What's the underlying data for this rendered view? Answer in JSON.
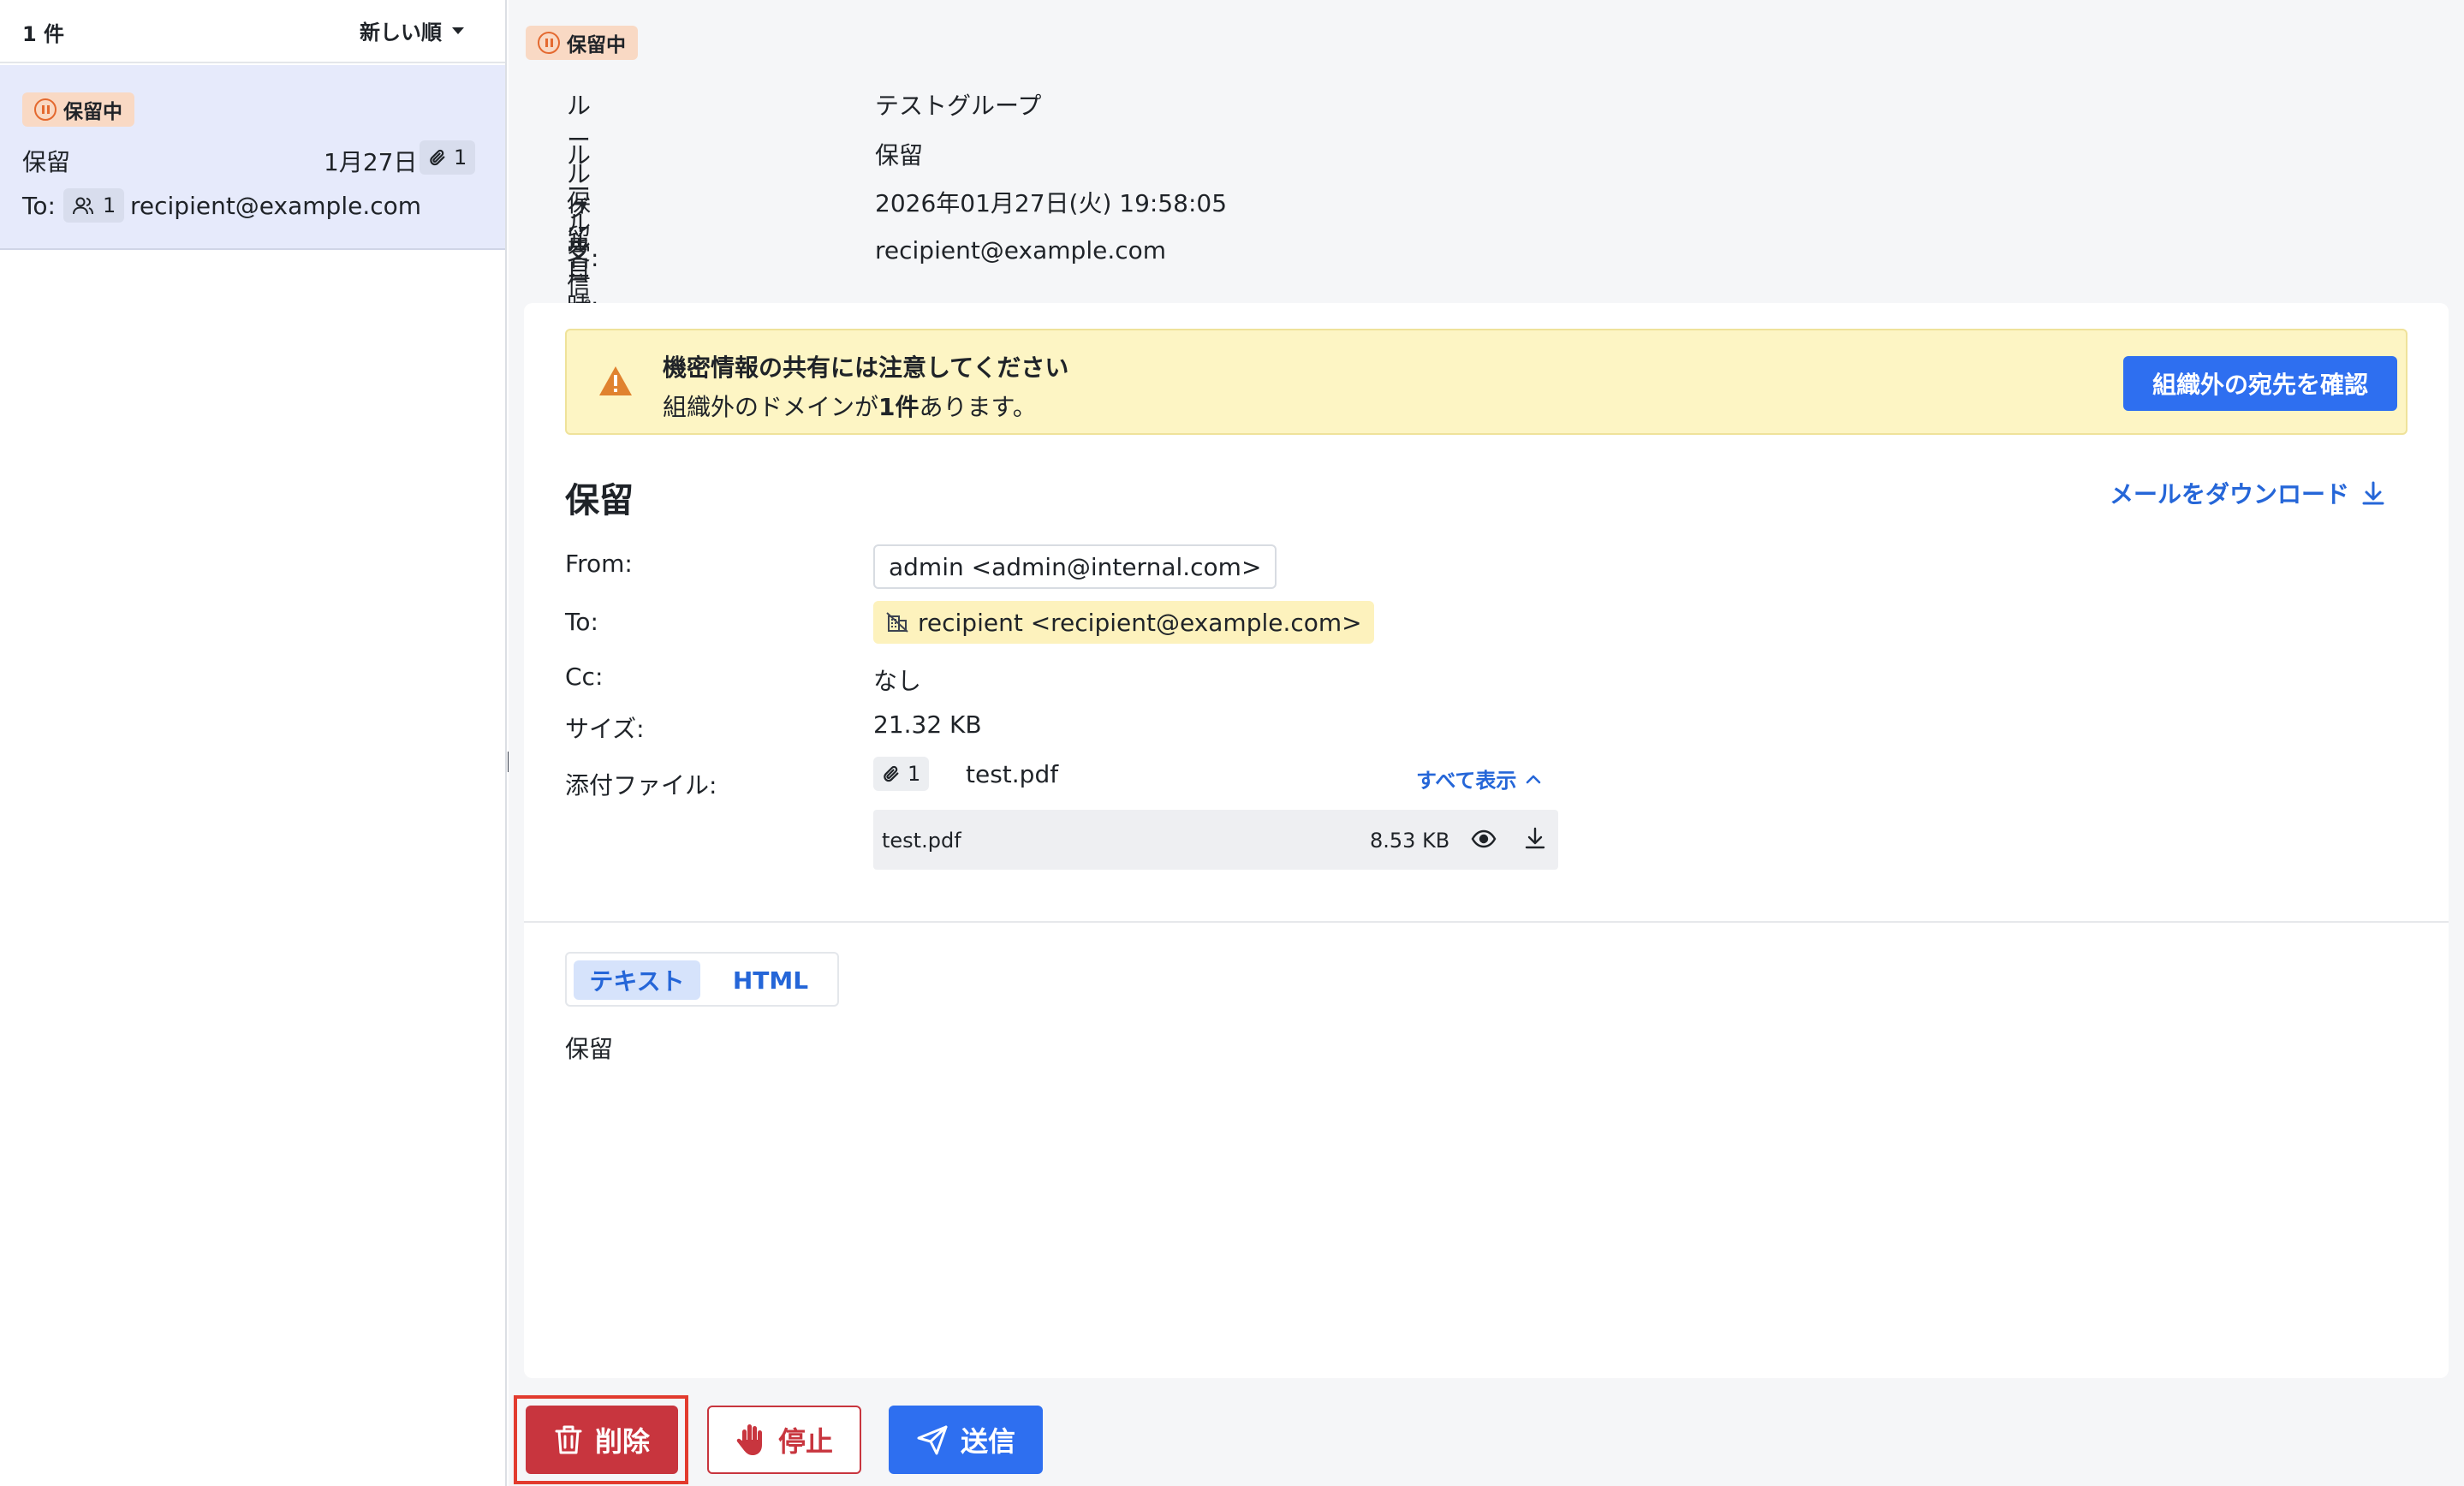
{
  "colors": {
    "accent": "#2e6ff0",
    "link": "#2566d8",
    "danger": "#c8353e",
    "hold_badge_bg": "#f9d9c4",
    "hold_icon": "#e4692f",
    "warning_bg": "#fdf5c4",
    "selected_item_bg": "#e6eafb",
    "focus_outline": "#e23b2e"
  },
  "list": {
    "count": "1 件",
    "sort_label": "新しい順",
    "items": [
      {
        "status": "保留中",
        "subject": "保留",
        "date": "1月27日",
        "attachment_count": "1",
        "to_label": "To:",
        "recipient_count": "1",
        "recipient": "recipient@example.com"
      }
    ]
  },
  "detail": {
    "status": "保留中",
    "meta": [
      {
        "key": "ルールグループ名:",
        "value": "テストグループ"
      },
      {
        "key": "ルール名:",
        "value": "保留"
      },
      {
        "key": "保留日時:",
        "value": "2026年01月27日(火) 19:58:05"
      },
      {
        "key": "受信者:",
        "value": "recipient@example.com"
      }
    ],
    "warning": {
      "title": "機密情報の共有には注意してください",
      "body_prefix": "組織外のドメインが",
      "body_bold": "1件",
      "body_suffix": "あります。",
      "button": "組織外の宛先を確認"
    },
    "mail": {
      "title": "保留",
      "download": "メールをダウンロード",
      "from_label": "From:",
      "from": "admin <admin@internal.com>",
      "to_label": "To:",
      "to": "recipient <recipient@example.com>",
      "cc_label": "Cc:",
      "cc": "なし",
      "size_label": "サイズ:",
      "size": "21.32 KB",
      "attach_label": "添付ファイル:",
      "attach_count": "1",
      "attach_summary": "test.pdf",
      "show_all": "すべて表示",
      "attachments": [
        {
          "name": "test.pdf",
          "size": "8.53 KB"
        }
      ],
      "tabs": [
        "テキスト",
        "HTML"
      ],
      "body": "保留"
    }
  },
  "actions": {
    "delete": "削除",
    "stop": "停止",
    "send": "送信"
  },
  "icons": {
    "hold": "pause-circle-icon",
    "sort": "caret-down-icon",
    "attachment": "paperclip-icon",
    "recipients": "users-icon",
    "warning": "warning-triangle-icon",
    "download": "download-icon",
    "external": "external-domain-icon",
    "show_all": "chevron-up-icon",
    "preview": "eye-icon",
    "delete": "trash-icon",
    "stop": "hand-stop-icon",
    "send": "send-icon"
  }
}
